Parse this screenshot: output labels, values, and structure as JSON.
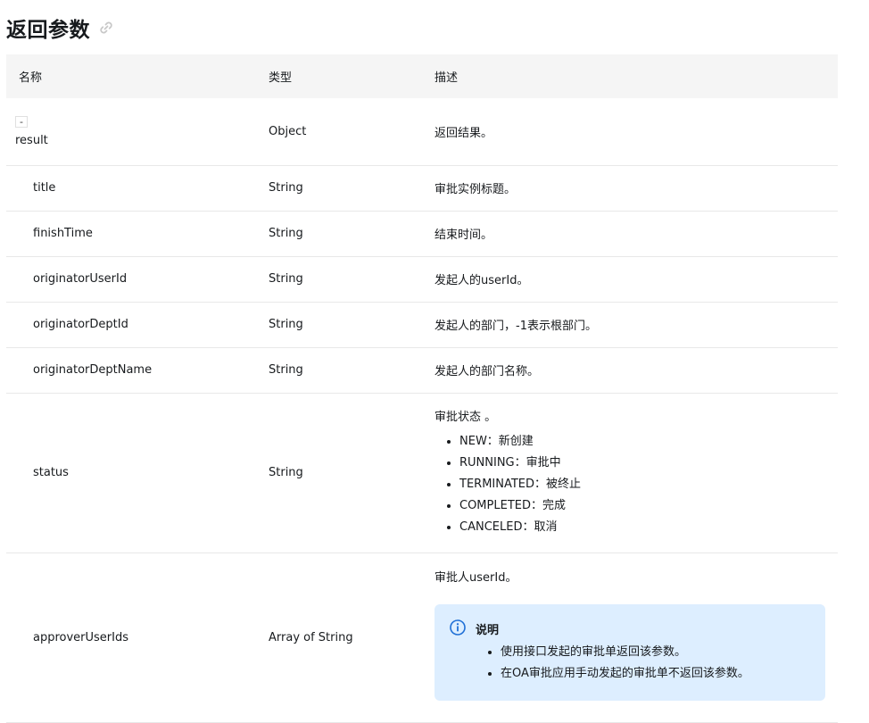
{
  "page": {
    "title": "返回参数"
  },
  "table": {
    "headers": {
      "name": "名称",
      "type": "类型",
      "desc": "描述"
    },
    "result": {
      "toggle": "-",
      "name": "result",
      "type": "Object",
      "desc": "返回结果。"
    },
    "rows": [
      {
        "name": "title",
        "type": "String",
        "desc": "审批实例标题。"
      },
      {
        "name": "finishTime",
        "type": "String",
        "desc": "结束时间。"
      },
      {
        "name": "originatorUserId",
        "type": "String",
        "desc": "发起人的userId。"
      },
      {
        "name": "originatorDeptId",
        "type": "String",
        "desc": "发起人的部门，-1表示根部门。"
      },
      {
        "name": "originatorDeptName",
        "type": "String",
        "desc": "发起人的部门名称。"
      }
    ],
    "status": {
      "name": "status",
      "type": "String",
      "desc": "审批状态 。",
      "items": [
        "NEW：新创建",
        "RUNNING：审批中",
        "TERMINATED：被终止",
        "COMPLETED：完成",
        "CANCELED：取消"
      ]
    },
    "approver": {
      "name": "approverUserIds",
      "type": "Array of String",
      "desc": "审批人userId。",
      "note": {
        "title": "说明",
        "items": [
          "使用接口发起的审批单返回该参数。",
          "在OA审批应用手动发起的审批单不返回该参数。"
        ]
      }
    }
  },
  "colors": {
    "note_bg": "#ddeeff",
    "info_icon": "#1f6fd6",
    "header_bg": "#f5f5f5"
  },
  "icons": {
    "title_link": "link-icon",
    "note_info": "info-icon"
  }
}
